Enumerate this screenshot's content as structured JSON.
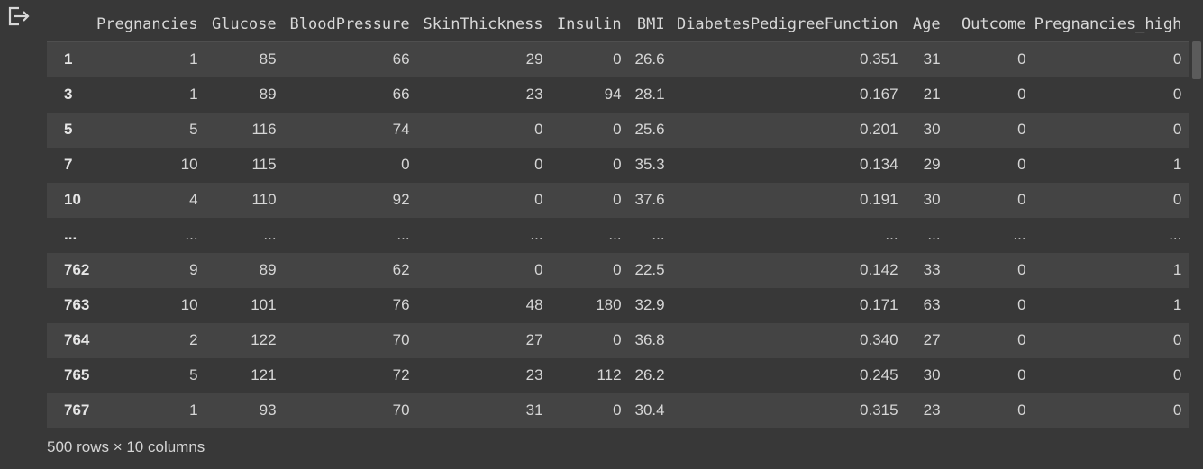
{
  "output_icon": "output-exit-icon",
  "table": {
    "columns": [
      "Pregnancies",
      "Glucose",
      "BloodPressure",
      "SkinThickness",
      "Insulin",
      "BMI",
      "DiabetesPedigreeFunction",
      "Age",
      "Outcome",
      "Pregnancies_high"
    ],
    "rows": [
      {
        "index": "1",
        "cells": [
          "1",
          "85",
          "66",
          "29",
          "0",
          "26.6",
          "0.351",
          "31",
          "0",
          "0"
        ]
      },
      {
        "index": "3",
        "cells": [
          "1",
          "89",
          "66",
          "23",
          "94",
          "28.1",
          "0.167",
          "21",
          "0",
          "0"
        ]
      },
      {
        "index": "5",
        "cells": [
          "5",
          "116",
          "74",
          "0",
          "0",
          "25.6",
          "0.201",
          "30",
          "0",
          "0"
        ]
      },
      {
        "index": "7",
        "cells": [
          "10",
          "115",
          "0",
          "0",
          "0",
          "35.3",
          "0.134",
          "29",
          "0",
          "1"
        ]
      },
      {
        "index": "10",
        "cells": [
          "4",
          "110",
          "92",
          "0",
          "0",
          "37.6",
          "0.191",
          "30",
          "0",
          "0"
        ]
      },
      {
        "index": "...",
        "cells": [
          "...",
          "...",
          "...",
          "...",
          "...",
          "...",
          "...",
          "...",
          "...",
          "..."
        ]
      },
      {
        "index": "762",
        "cells": [
          "9",
          "89",
          "62",
          "0",
          "0",
          "22.5",
          "0.142",
          "33",
          "0",
          "1"
        ]
      },
      {
        "index": "763",
        "cells": [
          "10",
          "101",
          "76",
          "48",
          "180",
          "32.9",
          "0.171",
          "63",
          "0",
          "1"
        ]
      },
      {
        "index": "764",
        "cells": [
          "2",
          "122",
          "70",
          "27",
          "0",
          "36.8",
          "0.340",
          "27",
          "0",
          "0"
        ]
      },
      {
        "index": "765",
        "cells": [
          "5",
          "121",
          "72",
          "23",
          "112",
          "26.2",
          "0.245",
          "30",
          "0",
          "0"
        ]
      },
      {
        "index": "767",
        "cells": [
          "1",
          "93",
          "70",
          "31",
          "0",
          "30.4",
          "0.315",
          "23",
          "0",
          "0"
        ]
      }
    ]
  },
  "shape_info": "500 rows × 10 columns"
}
